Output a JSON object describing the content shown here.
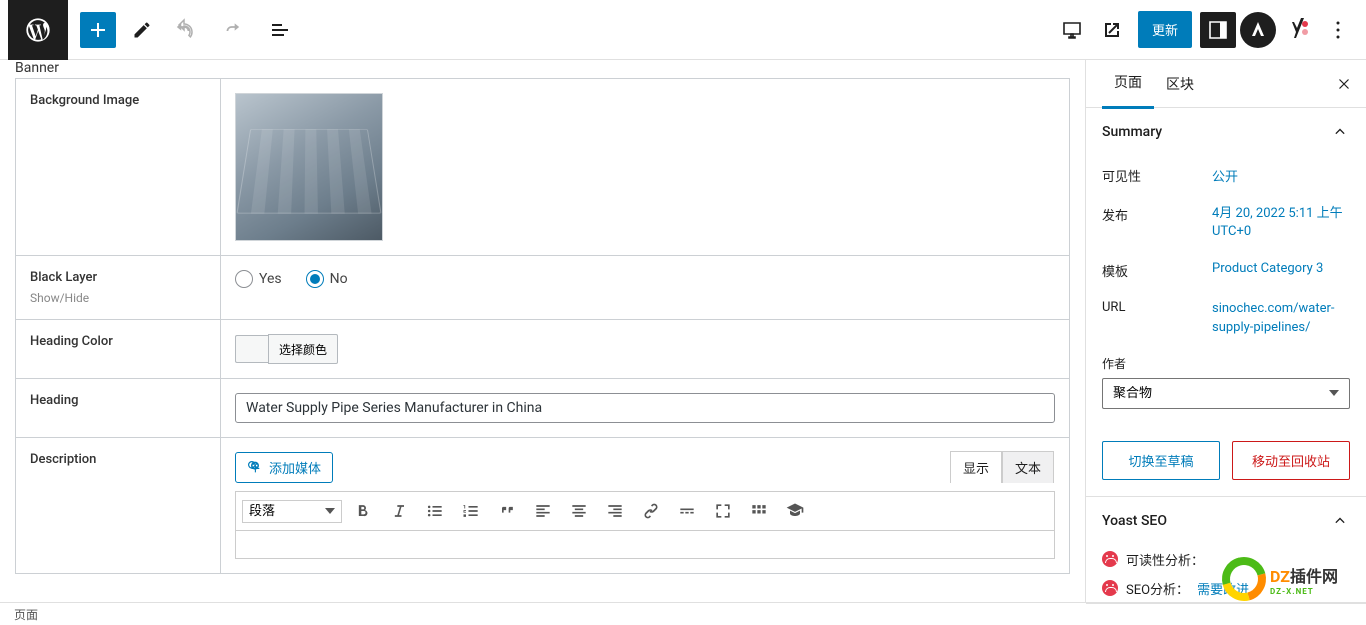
{
  "toolbar": {
    "update_label": "更新"
  },
  "panel": {
    "title": "Banner",
    "fields": {
      "bg_image_label": "Background Image",
      "black_layer_label": "Black Layer",
      "black_layer_sub": "Show/Hide",
      "yes": "Yes",
      "no": "No",
      "heading_color_label": "Heading Color",
      "choose_color": "选择颜色",
      "heading_label": "Heading",
      "heading_value": "Water Supply Pipe Series Manufacturer in China",
      "description_label": "Description",
      "add_media": "添加媒体",
      "ed_tab_visual": "显示",
      "ed_tab_text": "文本",
      "ed_format": "段落"
    }
  },
  "sidebar": {
    "tab_page": "页面",
    "tab_block": "区块",
    "summary_title": "Summary",
    "visibility_k": "可见性",
    "visibility_v": "公开",
    "publish_k": "发布",
    "publish_v": "4月 20, 2022 5:11 上午 UTC+0",
    "template_k": "模板",
    "template_v": "Product Category 3",
    "url_k": "URL",
    "url_v": "sinochec.com/water-supply-pipelines/",
    "author_label": "作者",
    "author_value": "聚合物",
    "draft_btn": "切换至草稿",
    "trash_btn": "移动至回收站",
    "yoast_title": "Yoast SEO",
    "readability_label": "可读性分析：",
    "seo_label": "SEO分析：",
    "seo_val": "需要改进"
  },
  "status": {
    "breadcrumb": "页面"
  },
  "watermark": {
    "a": "DZ",
    "b": "插件网",
    "sub": "DZ-X.NET"
  }
}
